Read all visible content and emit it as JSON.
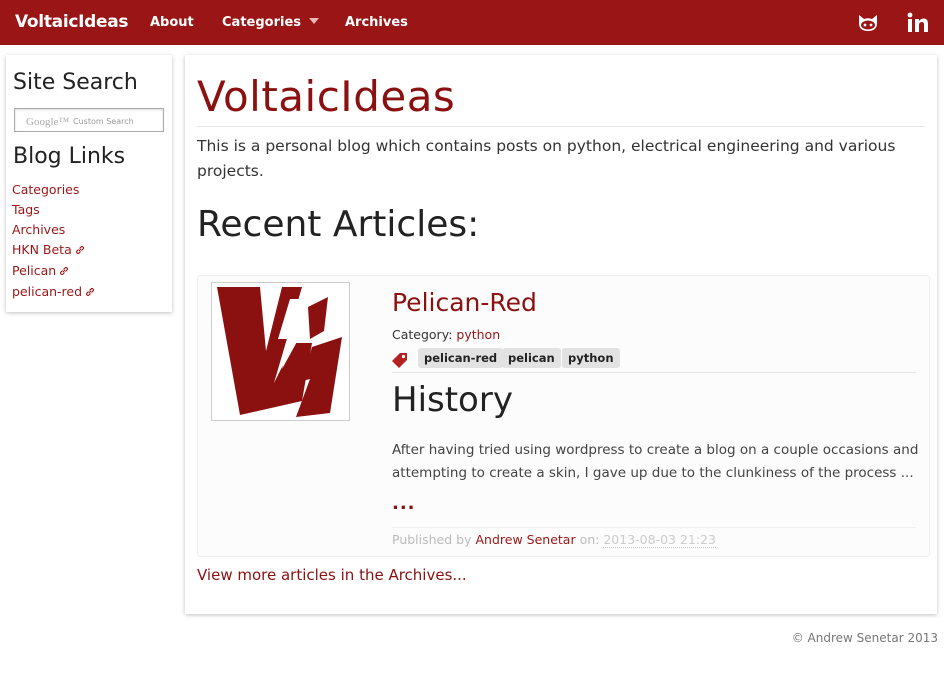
{
  "navbar": {
    "brand": "VoltaicIdeas",
    "links": [
      "About",
      "Categories",
      "Archives"
    ],
    "social": [
      {
        "icon": "github-icon"
      },
      {
        "icon": "linkedin-icon"
      }
    ],
    "bg_color": "#9a1616"
  },
  "sidebar": {
    "search_heading": "Site Search",
    "search_google": "Google™",
    "search_placeholder": "Custom Search",
    "links_heading": "Blog Links",
    "links": [
      {
        "label": "Categories",
        "external": false
      },
      {
        "label": "Tags",
        "external": false
      },
      {
        "label": "Archives",
        "external": false
      },
      {
        "label": "HKN Beta",
        "external": true
      },
      {
        "label": "Pelican",
        "external": true
      },
      {
        "label": "pelican-red",
        "external": true
      }
    ]
  },
  "main": {
    "title": "VoltaicIdeas",
    "intro": "This is a personal blog which contains posts on python, electrical engineering and various projects.",
    "recent_heading": "Recent Articles:",
    "article": {
      "title": "Pelican-Red",
      "category_label": "Category:",
      "category": "python",
      "tags": [
        "pelican-red",
        "pelican",
        "python"
      ],
      "heading": "History",
      "summary": "After having tried using wordpress to create a blog on a couple occasions and attempting to create a skin, I gave up due to the clunkiness of the process ...",
      "more": "...",
      "published_by": "Published by",
      "author": "Andrew Senetar",
      "on": "on:",
      "date": "2013-08-03 21:23"
    },
    "more_link": "View more articles in the Archives..."
  },
  "footer": {
    "text": "© Andrew Senetar 2013"
  },
  "colors": {
    "accent": "#8b1111",
    "link": "#9a1616"
  }
}
